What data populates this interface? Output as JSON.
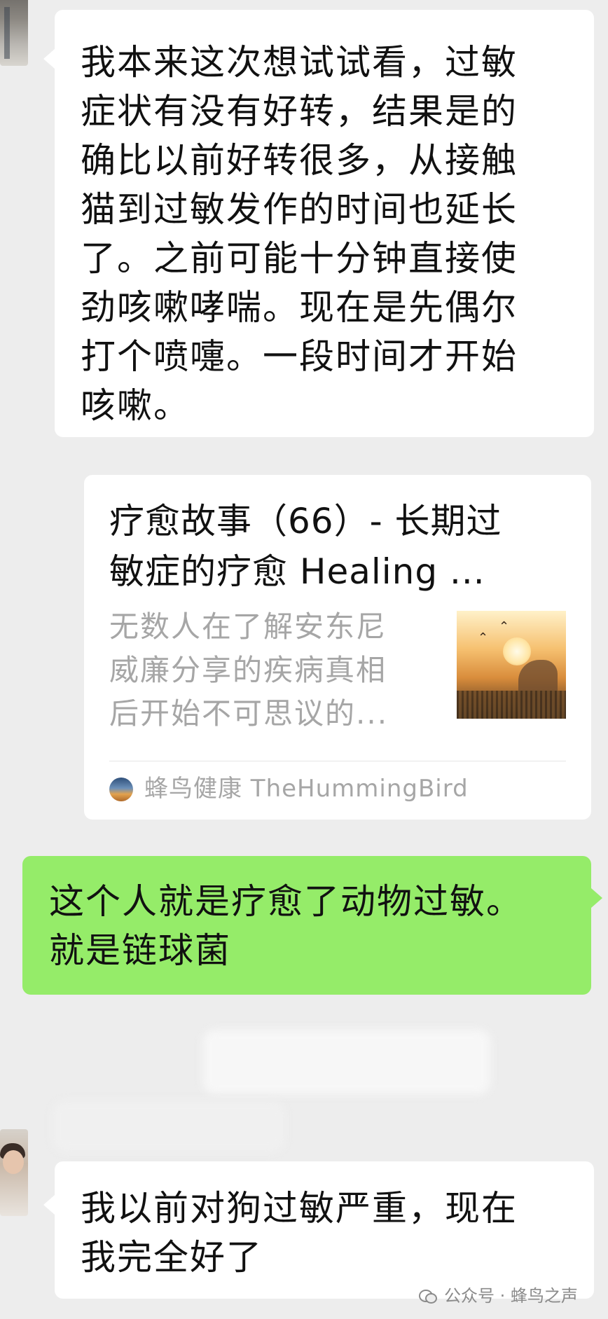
{
  "chat": {
    "messages": [
      {
        "side": "left",
        "text": "我本来这次想试试看，过敏\n症状有没有好转，结果是的\n确比以前好转很多，从接触\n猫到过敏发作的时间也延长\n了。之前可能十分钟直接使\n劲咳嗽哮喘。现在是先偶尔\n打个喷嚏。一段时间才开始\n咳嗽。"
      },
      {
        "side": "right",
        "text": "这个人就是疗愈了动物过敏。\n就是链球菌"
      },
      {
        "side": "left",
        "text": "我以前对狗过敏严重，现在\n我完全好了"
      }
    ],
    "link_card": {
      "title": "疗愈故事（66）- 长期过\n敏症的疗愈 Healing ...",
      "description": "无数人在了解安东尼\n威廉分享的疾病真相\n后开始不可思议的...",
      "source": "蜂鸟健康 TheHummingBird"
    },
    "colors": {
      "background": "#ededed",
      "bubble_white": "#ffffff",
      "bubble_green": "#95ec69",
      "muted_text": "#a6a6a6"
    }
  },
  "watermark": {
    "icon": "wechat-official-account-icon",
    "text": "公众号 · 蜂鸟之声"
  }
}
